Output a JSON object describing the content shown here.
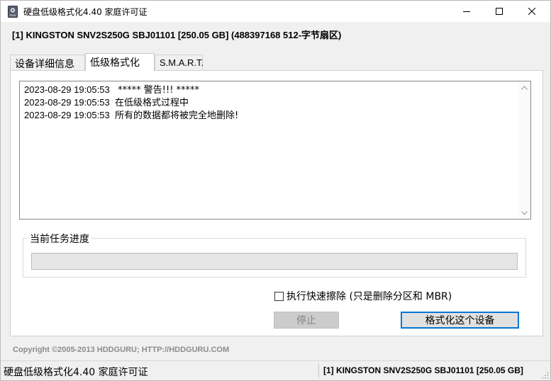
{
  "window": {
    "title": "硬盘低级格式化4.40    家庭许可证"
  },
  "device": {
    "summary": "[1]  KINGSTON SNV2S250G    SBJ01101    [250.05 GB]    (488397168 512-字节扇区)"
  },
  "tabs": [
    {
      "label": "设备详细信息",
      "active": false
    },
    {
      "label": "低级格式化",
      "active": true
    },
    {
      "label": "S.M.A.R.T.",
      "active": false
    }
  ],
  "log": {
    "entries": [
      {
        "time": "2023-08-29 19:05:53",
        "message": " ***** 警告!!! *****"
      },
      {
        "time": "2023-08-29 19:05:53",
        "message": "在低级格式过程中"
      },
      {
        "time": "2023-08-29 19:05:53",
        "message": "所有的数据都将被完全地删除!"
      }
    ]
  },
  "progress": {
    "label": "当前任务进度",
    "percent": 0
  },
  "quick_wipe": {
    "label": "执行快速擦除 (只是删除分区和 MBR)",
    "checked": false
  },
  "buttons": {
    "stop": "停止",
    "format": "格式化这个设备"
  },
  "footer": {
    "copyright": "Copyright ©2005-2013 HDDGURU;   HTTP://HDDGURU.COM"
  },
  "statusbar": {
    "left": "硬盘低级格式化4.40  家庭许可证",
    "right": "[1]  KINGSTON SNV2S250G    SBJ01101    [250.05 GB]"
  },
  "colors": {
    "accent": "#0078d7",
    "progress_fill": "#06b025"
  },
  "icons": {
    "app": "hdd-icon",
    "minimize": "minimize-icon",
    "maximize": "maximize-icon",
    "close": "close-icon",
    "scroll_up": "chevron-up-icon",
    "scroll_down": "chevron-down-icon"
  }
}
